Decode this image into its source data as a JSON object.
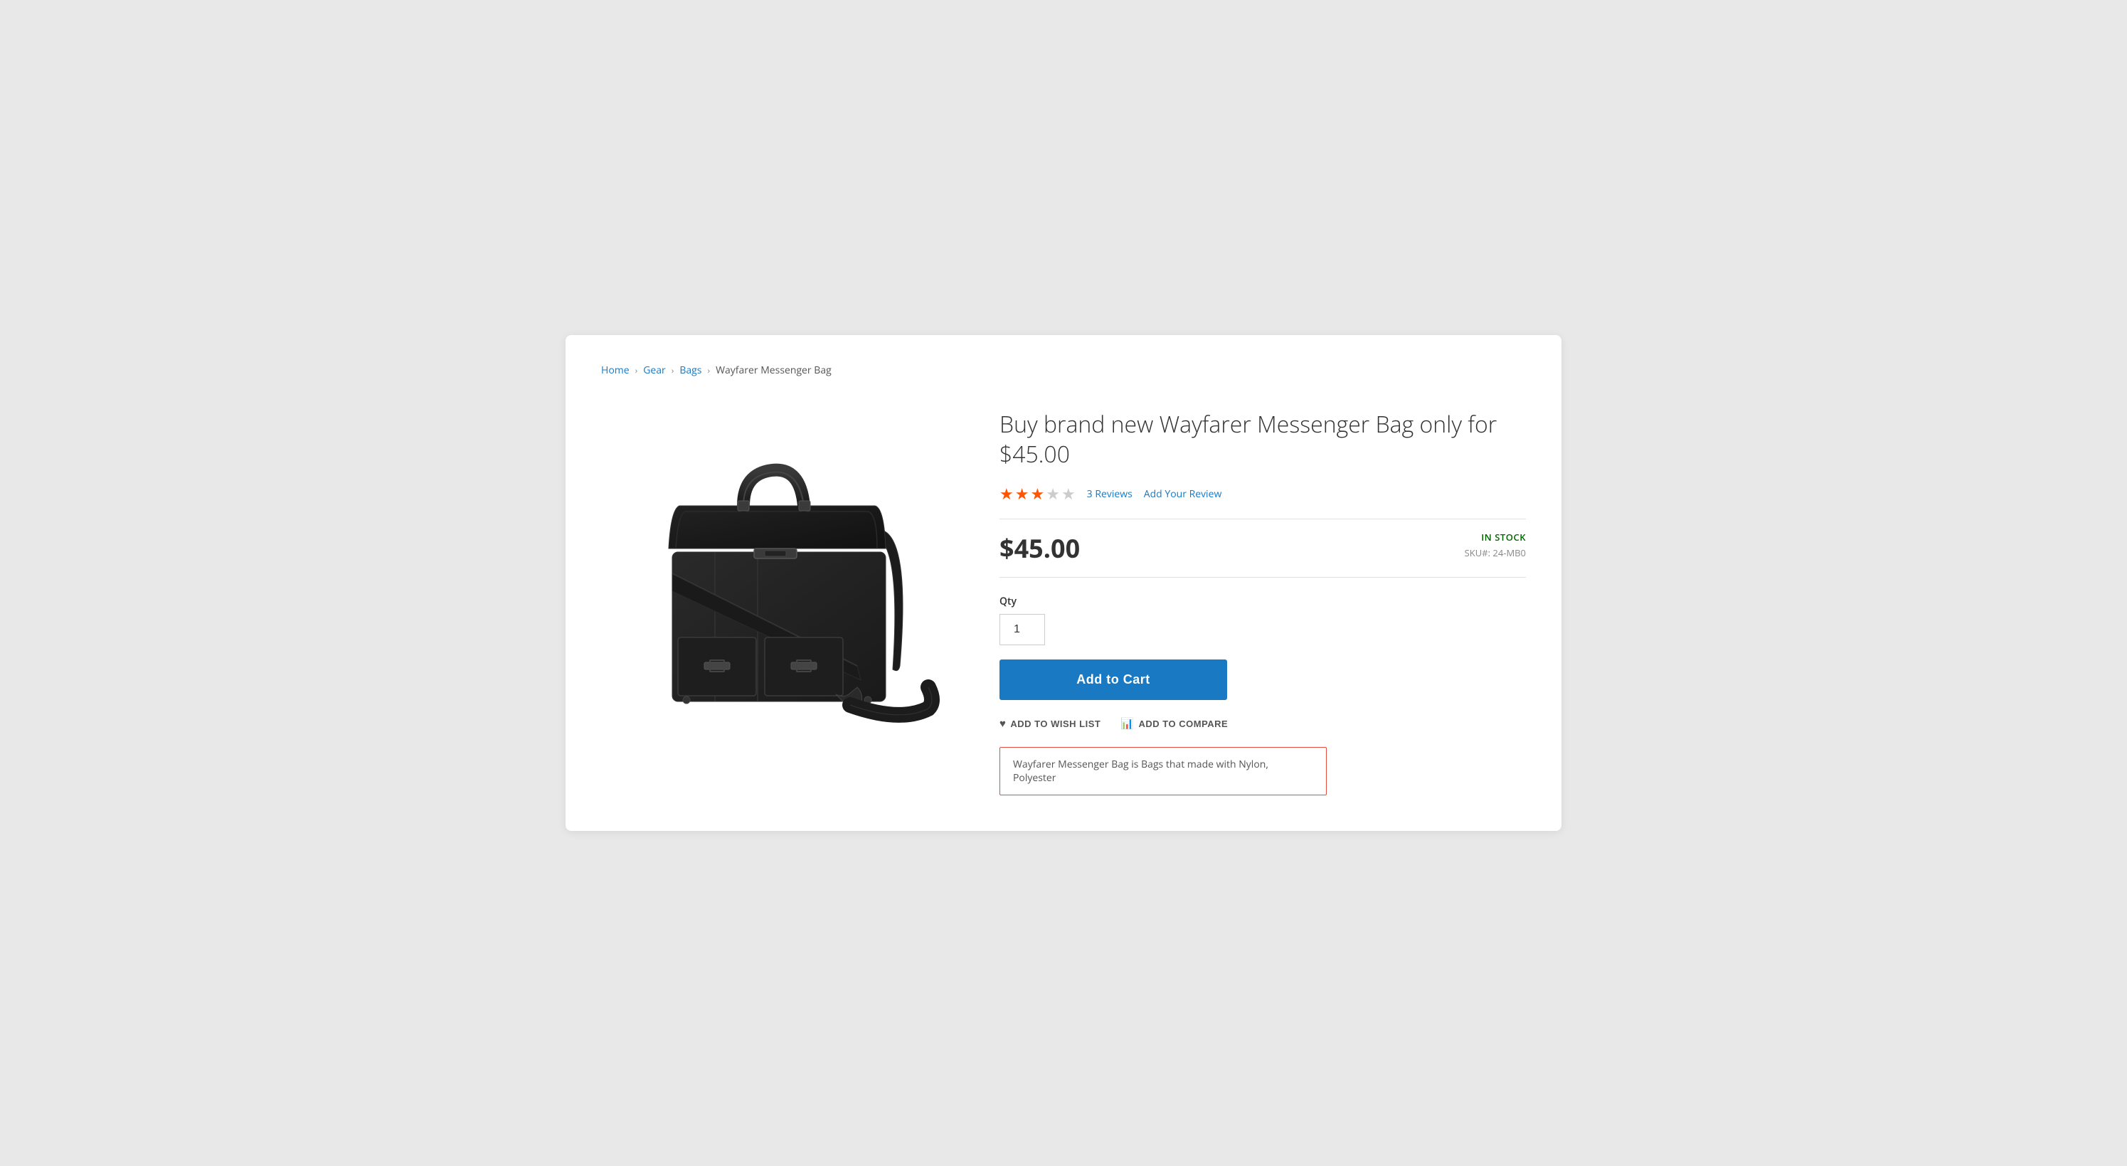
{
  "breadcrumb": {
    "home": "Home",
    "gear": "Gear",
    "bags": "Bags",
    "current": "Wayfarer Messenger Bag"
  },
  "product": {
    "title": "Buy brand new Wayfarer Messenger Bag only for $45.00",
    "price": "$45.00",
    "rating": {
      "filled": 3,
      "empty": 2,
      "count": "3",
      "reviews_label": "Reviews",
      "add_review": "Add Your Review"
    },
    "availability": "IN STOCK",
    "sku_label": "SKU#:",
    "sku": "24-MB0",
    "qty_label": "Qty",
    "qty_default": "1",
    "add_to_cart": "Add to Cart",
    "wish_list": "ADD TO WISH LIST",
    "compare": "ADD TO COMPARE",
    "description": "Wayfarer Messenger Bag is Bags that made with Nylon, Polyester"
  }
}
